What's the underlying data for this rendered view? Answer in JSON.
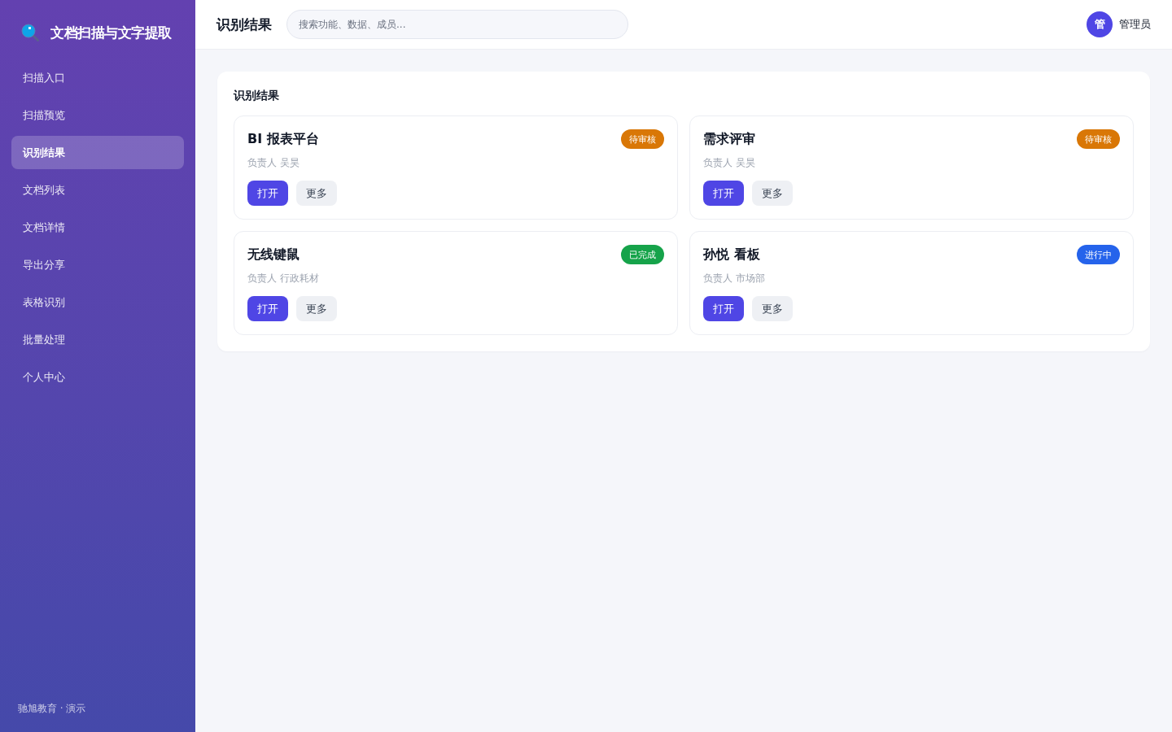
{
  "sidebar": {
    "brand": "文档扫描与文字提取",
    "items": [
      {
        "label": "扫描入口",
        "selected": false
      },
      {
        "label": "扫描预览",
        "selected": false
      },
      {
        "label": "识别结果",
        "selected": true
      },
      {
        "label": "文档列表",
        "selected": false
      },
      {
        "label": "文档详情",
        "selected": false
      },
      {
        "label": "导出分享",
        "selected": false
      },
      {
        "label": "表格识别",
        "selected": false
      },
      {
        "label": "批量处理",
        "selected": false
      },
      {
        "label": "个人中心",
        "selected": false
      }
    ],
    "footer": "驰旭教育 · 演示"
  },
  "topbar": {
    "title": "识别结果",
    "search": {
      "placeholder": "搜索功能、数据、成员..."
    },
    "user": {
      "avatar": "管",
      "name": "管理员"
    }
  },
  "panel": {
    "title": "识别结果",
    "cards": [
      {
        "title": "BI 报表平台",
        "status": {
          "label": "待审核",
          "color": "#d97706"
        },
        "owner": "负责人 吴昊",
        "buttons": [
          {
            "label": "打开",
            "kind": "primary"
          },
          {
            "label": "更多",
            "kind": "secondary"
          }
        ]
      },
      {
        "title": "需求评审",
        "status": {
          "label": "待审核",
          "color": "#d97706"
        },
        "owner": "负责人 吴昊",
        "buttons": [
          {
            "label": "打开",
            "kind": "primary"
          },
          {
            "label": "更多",
            "kind": "secondary"
          }
        ]
      },
      {
        "title": "无线键鼠",
        "status": {
          "label": "已完成",
          "color": "#16a34a"
        },
        "owner": "负责人 行政耗材",
        "buttons": [
          {
            "label": "打开",
            "kind": "primary"
          },
          {
            "label": "更多",
            "kind": "secondary"
          }
        ]
      },
      {
        "title": "孙悦 看板",
        "status": {
          "label": "进行中",
          "color": "#2563eb"
        },
        "owner": "负责人 市场部",
        "buttons": [
          {
            "label": "打开",
            "kind": "primary"
          },
          {
            "label": "更多",
            "kind": "secondary"
          }
        ]
      }
    ]
  }
}
